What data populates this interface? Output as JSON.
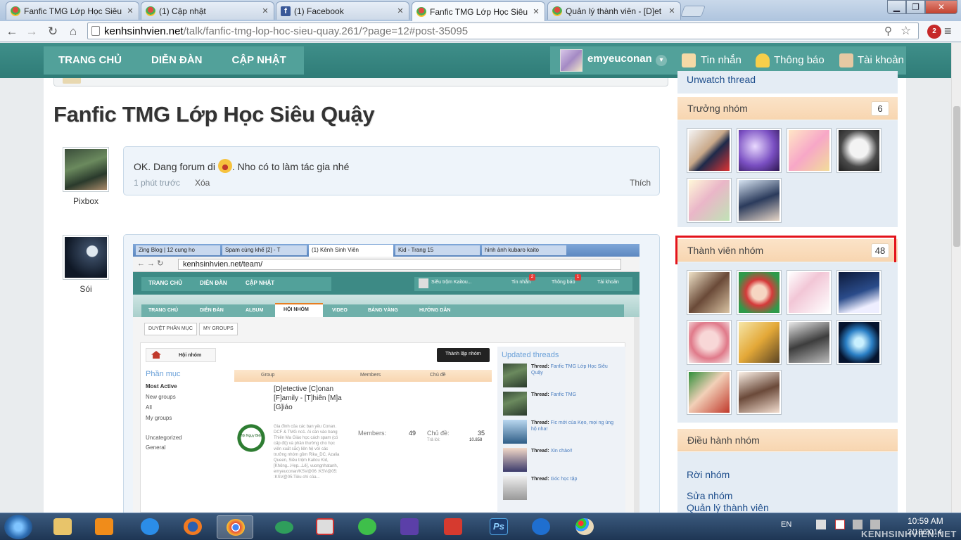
{
  "browser": {
    "tabs": [
      {
        "label": "Fanfic TMG Lớp Học Siêu",
        "icon": "chrome-favicon",
        "color": "#e24b3f"
      },
      {
        "label": "(1) Cập nhật",
        "icon": "chrome-favicon",
        "color": "#e24b3f"
      },
      {
        "label": "(1) Facebook",
        "icon": "facebook-favicon",
        "color": "#3b5998"
      },
      {
        "label": "Fanfic TMG Lớp Học Siêu",
        "icon": "chrome-favicon",
        "color": "#e24b3f"
      },
      {
        "label": "Quản lý thành viên - [D]et",
        "icon": "chrome-favicon",
        "color": "#e24b3f"
      }
    ],
    "url_host": "kenhsinhvien.net",
    "url_path": "/talk/fanfic-tmg-lop-hoc-sieu-quay.261/?page=12#post-35095"
  },
  "site": {
    "nav": [
      "TRANG CHỦ",
      "DIỄN ĐÀN",
      "CẬP NHẬT"
    ],
    "username": "emyeuconan",
    "messages": "Tin nhắn",
    "alerts": "Thông báo",
    "account": "Tài khoản",
    "accent": "#3a8a85"
  },
  "thread": {
    "title": "Fanfic TMG Lớp Học Siêu Quậy",
    "posts": [
      {
        "user": "Pixbox",
        "text": "OK. Dang forum di",
        "text_after": ". Nho có to làm tác gia nhé",
        "time": "1 phút trước",
        "delete": "Xóa",
        "like": "Thích"
      },
      {
        "user": "Sói"
      }
    ]
  },
  "embedded": {
    "tabs": [
      "Zing Blog | 12 cung ho",
      "Spam cùng khế [2] - T",
      "(1) Kênh Sinh Viên",
      "Kid - Trang 15",
      "hình ảnh kubaro kaito"
    ],
    "url": "kenhsinhvien.net/team/",
    "nav": [
      "TRANG CHỦ",
      "DIỄN ĐÀN",
      "CẬP NHẬT"
    ],
    "user": "Siêu trộm Kaitou...",
    "msg": "Tin nhắn",
    "msg_badge": "2",
    "alert": "Thông báo",
    "alert_badge": "1",
    "account": "Tài khoản",
    "tabs2": [
      "TRANG CHỦ",
      "DIỄN ĐÀN",
      "ALBUM",
      "HỘI NHÓM",
      "VIDEO",
      "BẢNG VÀNG",
      "HƯỚNG DẪN"
    ],
    "sub": [
      "DUYỆT PHẦN MỤC",
      "MY GROUPS"
    ],
    "crumb": "Hội nhóm",
    "create": "Thành lập nhóm",
    "cat_title": "Phần mục",
    "cats": [
      "Most Active",
      "New groups",
      "All",
      "My groups",
      "",
      "Uncategorized",
      "General"
    ],
    "cols": [
      "Group",
      "Members",
      "Chủ đề"
    ],
    "group_name": "[D]etective [C]onan [F]amily - [T]hiên [M]a [G]iáo",
    "group_desc": "Gia đình của các bạn yêu Conan. DCF & TMG no1. Ai cần vào bang Thiên Ma Giáo học cách spam (có cấp độ) và phần thưởng cho học viên xuất sắc) liên hệ với các trưởng nhóm gồm Rika_DC, Azalia Queen, Siêu trộm Kaitou Kid, [Không...Hẹp...Lẻ], vuongnhatanh, emyeuconan/KSV@06 :KSV@05: :KSV@05:Tiêu chí của...",
    "logo_text": "Hội Ngụy Biện",
    "members_label": "Members:",
    "members": "49",
    "topics_label": "Chủ đề:",
    "topics": "35",
    "replies_label": "Trả lời:",
    "replies": "10.858",
    "updated_title": "Updated threads",
    "updated": [
      {
        "label": "Thread:",
        "text": "Fanfic TMG Lớp Học Siêu Quậy"
      },
      {
        "label": "Thread:",
        "text": "Fanfic TMG"
      },
      {
        "label": "Thread:",
        "text": "Fic mới của Kẹo, mọi ng ủng hộ nha!"
      },
      {
        "label": "Thread:",
        "text": "Xin chào!!"
      },
      {
        "label": "Thread:",
        "text": "Góc học tập"
      }
    ]
  },
  "sidebar": {
    "unwatch": "Unwatch thread",
    "leaders_title": "Trưởng nhóm",
    "leaders_count": "6",
    "members_title": "Thành viên nhóm",
    "members_count": "48",
    "mods_title": "Điều hành nhóm",
    "actions": [
      "Rời nhóm",
      "Sửa nhóm",
      "Quản lý thành viên"
    ]
  },
  "taskbar": {
    "lang": "EN",
    "time": "10:59 AM",
    "date": "2/18/2014",
    "watermark": "KENHSINHVIEN.NET",
    "apps": [
      "explorer-icon",
      "media-player-icon",
      "ie-icon",
      "firefox-icon",
      "chrome-icon",
      "vinaphone-icon",
      "unikey-icon",
      "bird-icon",
      "app-icon",
      "video-icon",
      "photoshop-icon",
      "teamviewer-icon",
      "paint-icon"
    ]
  }
}
